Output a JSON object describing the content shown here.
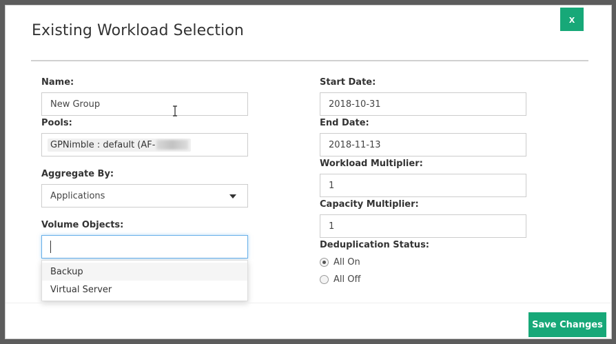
{
  "modal": {
    "title": "Existing Workload Selection",
    "close_label": "x",
    "save_label": "Save Changes"
  },
  "left": {
    "name_label": "Name:",
    "name_value": "New Group",
    "pools_label": "Pools:",
    "pools_value": "GPNimble : default (AF-",
    "aggregate_label": "Aggregate By:",
    "aggregate_value": "Applications",
    "volume_label": "Volume Objects:",
    "volume_value": "",
    "volume_options": [
      "Backup",
      "Virtual Server"
    ]
  },
  "right": {
    "start_label": "Start Date:",
    "start_value": "2018-10-31",
    "end_label": "End Date:",
    "end_value": "2018-11-13",
    "workload_label": "Workload Multiplier:",
    "workload_value": "1",
    "capacity_label": "Capacity Multiplier:",
    "capacity_value": "1",
    "dedup_label": "Deduplication Status:",
    "dedup_options": [
      "All On",
      "All Off"
    ],
    "dedup_selected": "All On"
  },
  "colors": {
    "accent": "#17a878",
    "focus": "#66afe9"
  }
}
